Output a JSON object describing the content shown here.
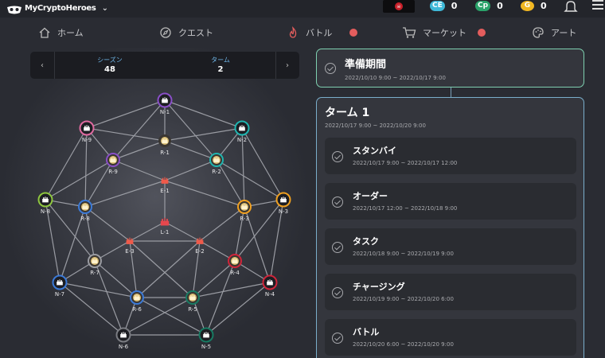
{
  "header": {
    "logo_text": "MyCryptoHeroes",
    "tokens": [
      {
        "badge": "CE",
        "value": "0",
        "color": "#3fb9d8"
      },
      {
        "badge": "Cp",
        "value": "0",
        "color": "#2aa36a"
      },
      {
        "badge": "G",
        "value": "0",
        "color": "#f1b722"
      }
    ]
  },
  "nav": {
    "items": [
      {
        "label": "ホーム",
        "icon": "home-icon"
      },
      {
        "label": "クエスト",
        "icon": "compass-icon"
      },
      {
        "label": "バトル",
        "icon": "fire-icon",
        "active": true
      },
      {
        "label": "マーケット",
        "icon": "cart-icon"
      },
      {
        "label": "アート",
        "icon": "palette-icon"
      }
    ]
  },
  "season_bar": {
    "season_label": "シーズン",
    "season_value": "48",
    "turn_label": "ターム",
    "turn_value": "2"
  },
  "map": {
    "nodes": [
      {
        "id": "N-1",
        "color": "#8a4fc8"
      },
      {
        "id": "N-2",
        "color": "#1fb5b0"
      },
      {
        "id": "N-3",
        "color": "#f0a020"
      },
      {
        "id": "N-4",
        "color": "#d0243a"
      },
      {
        "id": "N-5",
        "color": "#177a62"
      },
      {
        "id": "N-6",
        "color": "#7a7c82"
      },
      {
        "id": "N-7",
        "color": "#3b7ad8"
      },
      {
        "id": "N-8",
        "color": "#8ec63f"
      },
      {
        "id": "N-9",
        "color": "#e06aa0"
      },
      {
        "id": "R-1",
        "color": ""
      },
      {
        "id": "R-2",
        "color": "#1fb5b0"
      },
      {
        "id": "R-3",
        "color": "#f0a020"
      },
      {
        "id": "R-4",
        "color": "#d0243a"
      },
      {
        "id": "R-5",
        "color": "#177a62"
      },
      {
        "id": "R-6",
        "color": "#3b7ad8"
      },
      {
        "id": "R-7",
        "color": "#9a9ca2"
      },
      {
        "id": "R-8",
        "color": "#3b7ad8"
      },
      {
        "id": "R-9",
        "color": "#8a4fc8"
      },
      {
        "id": "E-1",
        "color": ""
      },
      {
        "id": "E-2",
        "color": ""
      },
      {
        "id": "E-3",
        "color": ""
      },
      {
        "id": "L-1",
        "color": ""
      }
    ]
  },
  "prep": {
    "title": "準備期間",
    "date": "2022/10/10 9:00 ~ 2022/10/17 9:00"
  },
  "turn": {
    "title": "ターム 1",
    "date": "2022/10/17 9:00 ~ 2022/10/20 9:00",
    "phases": [
      {
        "title": "スタンバイ",
        "date": "2022/10/17 9:00 ~ 2022/10/17 12:00"
      },
      {
        "title": "オーダー",
        "date": "2022/10/17 12:00 ~ 2022/10/18 9:00"
      },
      {
        "title": "タスク",
        "date": "2022/10/18 9:00 ~ 2022/10/19 9:00"
      },
      {
        "title": "チャージング",
        "date": "2022/10/19 9:00 ~ 2022/10/20 6:00"
      },
      {
        "title": "バトル",
        "date": "2022/10/20 6:00 ~ 2022/10/20 9:00"
      }
    ]
  }
}
